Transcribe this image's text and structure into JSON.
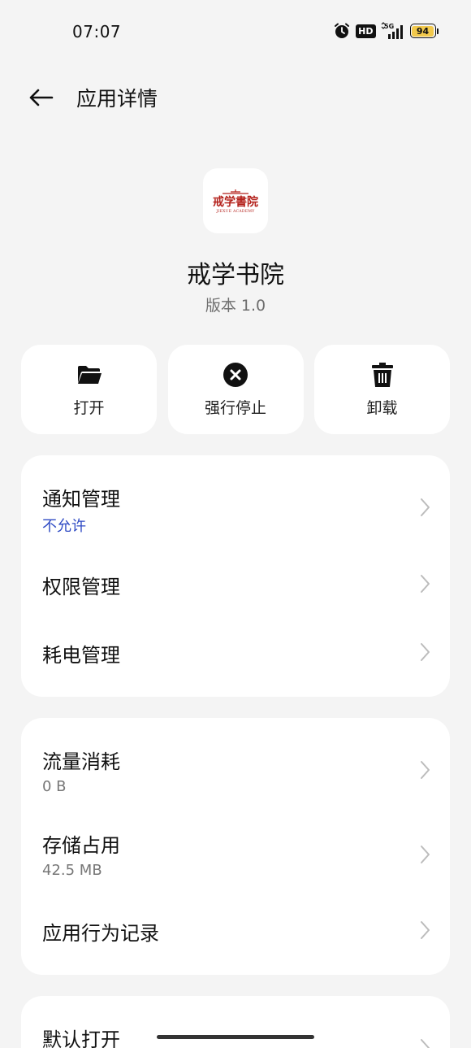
{
  "status_bar": {
    "time": "07:07",
    "hd_label": "HD",
    "network_label": "5G",
    "battery_level": "94",
    "battery_color": "#f2c94c"
  },
  "header": {
    "title": "应用详情",
    "back_icon": "arrow-left-icon"
  },
  "app": {
    "icon_text": "戒学書院",
    "icon_subtext": "JIEXUE ACADEMY",
    "name": "戒学书院",
    "version": "版本 1.0"
  },
  "actions": [
    {
      "label": "打开",
      "icon": "folder-icon"
    },
    {
      "label": "强行停止",
      "icon": "force-stop-icon"
    },
    {
      "label": "卸载",
      "icon": "trash-icon"
    }
  ],
  "card_1": [
    {
      "title": "通知管理",
      "subtitle": "不允许"
    },
    {
      "title": "权限管理"
    },
    {
      "title": "耗电管理"
    }
  ],
  "card_2": [
    {
      "title": "流量消耗",
      "subtitle": "0 B"
    },
    {
      "title": "存储占用",
      "subtitle": "42.5 MB"
    },
    {
      "title": "应用行为记录"
    }
  ],
  "card_3": [
    {
      "title": "默认打开"
    }
  ],
  "colors": {
    "background": "#f4f4f4",
    "card": "#ffffff",
    "accent_blue": "#2f4bc4",
    "brand_red": "#b4221c"
  }
}
